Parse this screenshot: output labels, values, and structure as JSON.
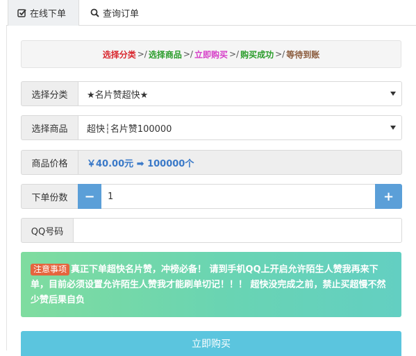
{
  "tabs": [
    {
      "label": "在线下单",
      "icon": "check-square-icon",
      "active": true
    },
    {
      "label": "查询订单",
      "icon": "search-icon",
      "active": false
    }
  ],
  "steps": [
    {
      "label": "选择分类",
      "color": "#d9272e"
    },
    {
      "label": "选择商品",
      "color": "#2b9d2b"
    },
    {
      "label": "立即购买",
      "color": "#d63fc8"
    },
    {
      "label": "购买成功",
      "color": "#2b9d2b"
    },
    {
      "label": "等待到账",
      "color": "#8a5a3b"
    }
  ],
  "step_separator": ">/",
  "form": {
    "category": {
      "label": "选择分类",
      "value": "★名片赞超快★"
    },
    "product": {
      "label": "选择商品",
      "value": "超快┆名片赞100000"
    },
    "price": {
      "label": "商品价格",
      "value": "￥40.00元 ➡ 100000个"
    },
    "quantity": {
      "label": "下单份数",
      "value": "1",
      "minus": "−",
      "plus": "+"
    },
    "qq": {
      "label": "QQ号码",
      "value": ""
    }
  },
  "notice": {
    "badge": "注意事项",
    "text": "真正下单超快名片赞，冲榜必备！ 请到手机QQ上开启允许陌生人赞我再来下单，目前必须设置允许陌生人赞我才能刷单切记！！！ 超快没完成之前，禁止买超慢不然少赞后果自负"
  },
  "submit_label": "立即购买",
  "colors": {
    "accent": "#5b9fd8",
    "submit": "#5bc5de",
    "badge": "#e5653e"
  }
}
